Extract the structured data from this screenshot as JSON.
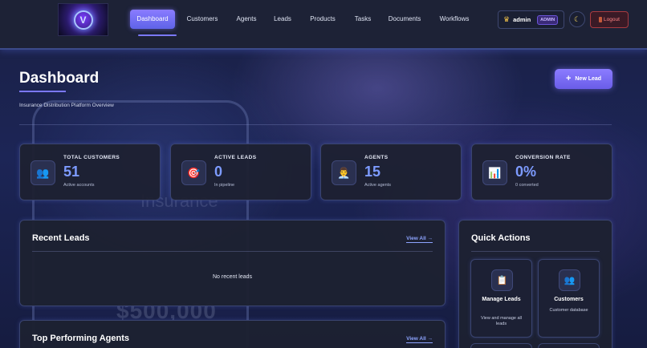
{
  "nav": {
    "items": [
      {
        "label": "Dashboard",
        "active": true
      },
      {
        "label": "Customers",
        "active": false
      },
      {
        "label": "Agents",
        "active": false
      },
      {
        "label": "Leads",
        "active": false
      },
      {
        "label": "Products",
        "active": false
      },
      {
        "label": "Tasks",
        "active": false
      },
      {
        "label": "Documents",
        "active": false
      },
      {
        "label": "Workflows",
        "active": false
      }
    ],
    "user": {
      "name": "admin",
      "role": "ADMIN",
      "icon": "crown-icon"
    },
    "theme_icon": "moon-icon",
    "logout_label": "Logout"
  },
  "header": {
    "title": "Dashboard",
    "subtitle": "Insurance Distribution Platform Overview",
    "new_lead_label": "New Lead"
  },
  "background": {
    "amount_text": "$500,000",
    "brand_text": "Insurance"
  },
  "stats": [
    {
      "label": "TOTAL CUSTOMERS",
      "value": "51",
      "sub": "Active accounts",
      "icon": "people-icon"
    },
    {
      "label": "ACTIVE LEADS",
      "value": "0",
      "sub": "In pipeline",
      "icon": "target-icon"
    },
    {
      "label": "AGENTS",
      "value": "15",
      "sub": "Active agents",
      "icon": "agent-icon"
    },
    {
      "label": "CONVERSION RATE",
      "value": "0%",
      "sub": "0 converted",
      "icon": "bar-chart-icon"
    }
  ],
  "recent_leads": {
    "title": "Recent Leads",
    "view_all": "View All →",
    "empty": "No recent leads"
  },
  "top_agents": {
    "title": "Top Performing Agents",
    "view_all": "View All →"
  },
  "quick_actions": {
    "title": "Quick Actions",
    "items": [
      {
        "title": "Manage Leads",
        "desc": "View and manage all leads",
        "icon": "clipboard-icon"
      },
      {
        "title": "Customers",
        "desc": "Customer database",
        "icon": "people-icon"
      }
    ]
  },
  "colors": {
    "accent": "#7b78ff",
    "stat_value": "#7d9bff",
    "logout": "#ff8585"
  }
}
